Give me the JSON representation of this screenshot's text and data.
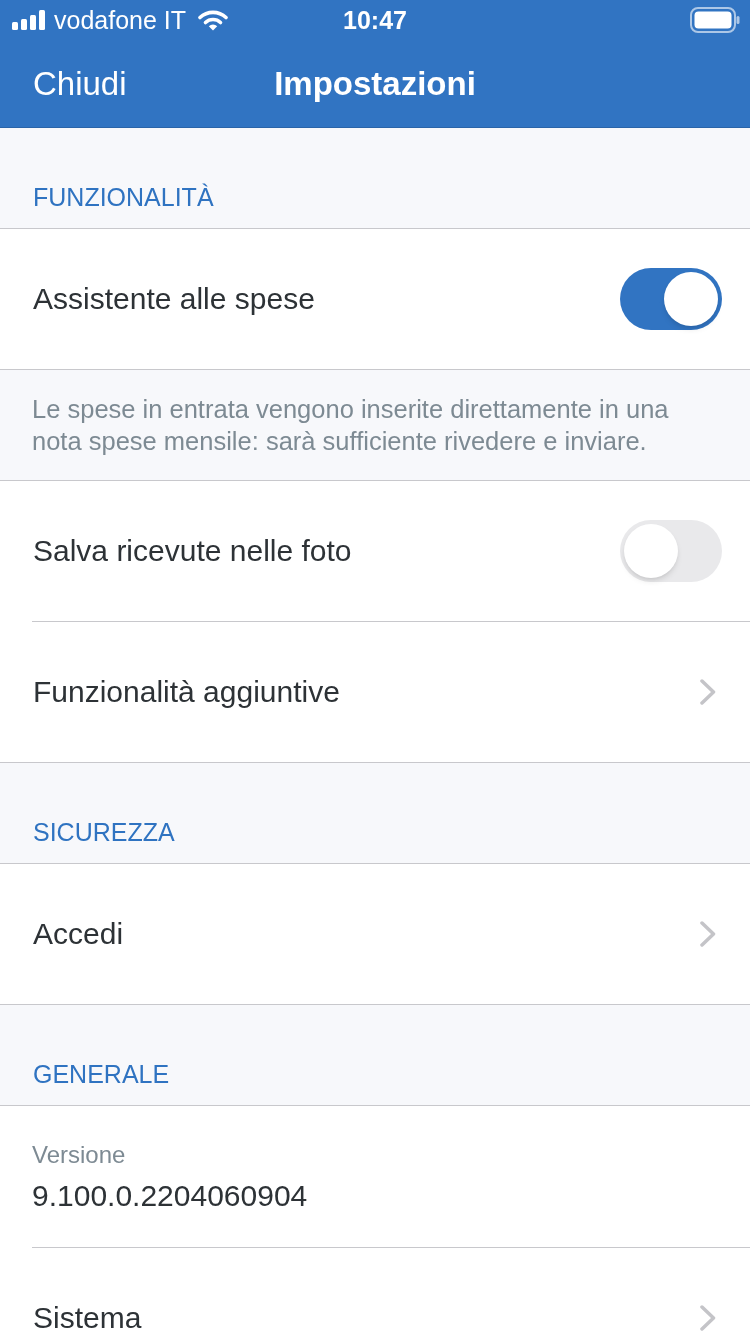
{
  "status_bar": {
    "carrier": "vodafone IT",
    "time": "10:47"
  },
  "nav_bar": {
    "left_button": "Chiudi",
    "title": "Impostazioni"
  },
  "sections": [
    {
      "header": "FUNZIONALITÀ",
      "rows": [
        {
          "kind": "toggle",
          "label": "Assistente alle spese",
          "on": true
        },
        {
          "kind": "note",
          "text": "Le spese in entrata vengono inserite direttamente in una nota spese mensile: sarà sufficiente rivedere e inviare."
        },
        {
          "kind": "toggle",
          "label": "Salva ricevute nelle foto",
          "on": false
        },
        {
          "kind": "link",
          "label": "Funzionalità aggiuntive"
        }
      ]
    },
    {
      "header": "SICUREZZA",
      "rows": [
        {
          "kind": "link",
          "label": "Accedi"
        }
      ]
    },
    {
      "header": "GENERALE",
      "rows": [
        {
          "kind": "info",
          "label": "Versione",
          "value": "9.100.0.2204060904"
        },
        {
          "kind": "link",
          "label": "Sistema"
        }
      ]
    }
  ]
}
